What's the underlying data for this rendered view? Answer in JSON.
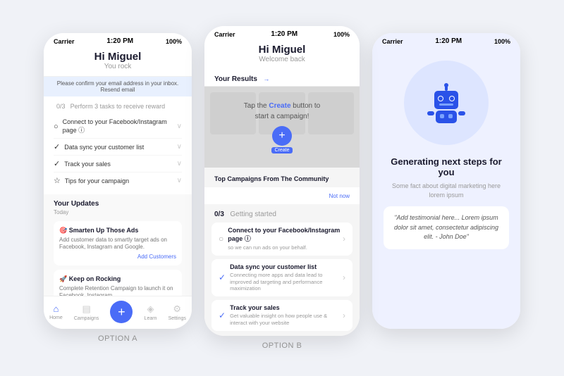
{
  "background": "#f0f2f7",
  "phones": {
    "a": {
      "option_label": "OPTION A",
      "status": {
        "carrier": "Carrier",
        "time": "1:20 PM",
        "battery": "100%"
      },
      "header": {
        "greeting": "Hi Miguel",
        "sub": "You rock"
      },
      "confirm_banner": "Please confirm your email address in your inbox. Resend email",
      "tasks": {
        "header": "0/3",
        "sub_label": "Perform 3 tasks to receive reward",
        "items": [
          {
            "icon": "○",
            "text": "Connect to your Facebook/Instagram page ⓘ"
          },
          {
            "icon": "✓",
            "text": "Data sync your customer list"
          },
          {
            "icon": "✓",
            "text": "Track your sales"
          },
          {
            "icon": "☆",
            "text": "Tips for your campaign"
          }
        ]
      },
      "updates": {
        "title": "Your Updates",
        "date": "Today",
        "cards": [
          {
            "title": "🎯 Smarten Up Those Ads",
            "desc": "Add customer data to smartly target ads on Facebook, Instagram and Google.",
            "link": "Add Customers"
          },
          {
            "title": "🚀 Keep on Rocking",
            "desc": "Complete Retention Campaign to launch it on Facebook, Instagram ...",
            "link": ""
          }
        ]
      },
      "nav": {
        "items": [
          {
            "icon": "⌂",
            "label": "Home",
            "active": true
          },
          {
            "icon": "◫",
            "label": "Campaigns"
          },
          {
            "icon": "+",
            "label": "Create",
            "is_create": true
          },
          {
            "icon": "◈",
            "label": "Learn"
          },
          {
            "icon": "⚙",
            "label": "Settings"
          }
        ]
      }
    },
    "b": {
      "option_label": "OPTION B",
      "status": {
        "carrier": "Carrier",
        "time": "1:20 PM",
        "battery": "100%"
      },
      "header": {
        "greeting": "Hi Miguel",
        "sub": "Welcome back"
      },
      "your_results": "Your Results",
      "campaign_prompt_line1": "Tap the",
      "campaign_prompt_highlight": "Create",
      "campaign_prompt_line2": "button to",
      "campaign_prompt_line3": "start a campaign!",
      "not_now": "Not now",
      "getting_started": "0/3",
      "getting_started_label": "Getting started",
      "tasks": [
        {
          "icon": "○",
          "title": "Connect to your Facebook/Instagram page ⓘ",
          "sub": "so we can run ads on your behalf."
        },
        {
          "icon": "✓",
          "title": "Data sync your customer list",
          "sub": "Connecting more apps and data lead to improved ad targeting and performance maximization"
        },
        {
          "icon": "✓",
          "title": "Track your sales",
          "sub": "Get valuable insight on how people use & interact with your website"
        }
      ]
    },
    "c": {
      "status": {
        "carrier": "Carrier",
        "time": "1:20 PM",
        "battery": "100%"
      },
      "title": "Generating next steps for you",
      "sub": "Some fact about digital marketing here lorem ipsum",
      "testimonial": "\"Add testimonial here... Lorem ipsum dolor sit amet, consectetur adipiscing elit. - John Doe\""
    }
  }
}
